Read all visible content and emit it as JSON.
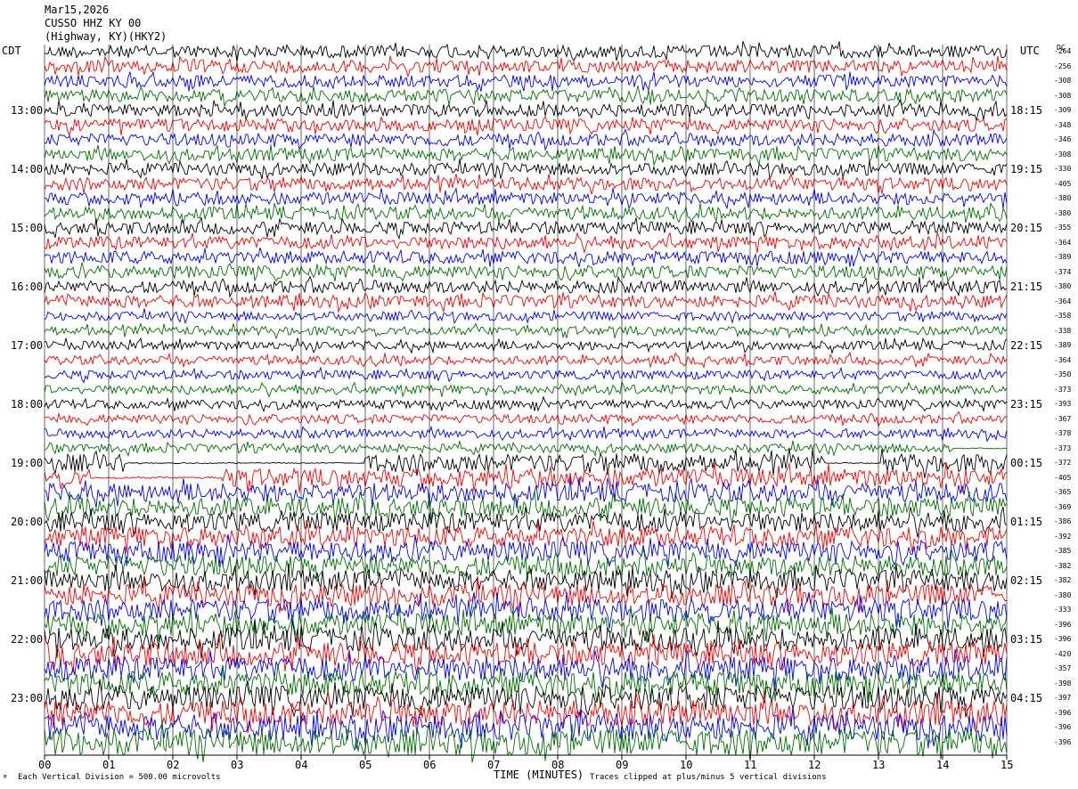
{
  "header": {
    "date": "Mar15,2026",
    "station": "CUSSO HHZ KY 00",
    "location": "(Highway, KY)(HKY2)"
  },
  "left_axis_title": "CDT",
  "right_axis_title": "UTC",
  "right_corner": "DC",
  "footer": {
    "scale_note": "Each Vertical Division =  500.00 microvolts",
    "xlabel": "TIME (MINUTES)",
    "clip_note": "Traces clipped at plus/minus 5 vertical divisions",
    "corner_mark": "ᴹ"
  },
  "colors": {
    "trace_cycle": [
      "#000000",
      "#ff0000",
      "#0000ff",
      "#007000"
    ]
  },
  "chart_data": {
    "type": "line",
    "title": "CUSSO HHZ KY 00",
    "xlabel": "TIME (MINUTES)",
    "xlim": [
      0,
      15
    ],
    "x_ticks": [
      "00",
      "01",
      "02",
      "03",
      "04",
      "05",
      "06",
      "07",
      "08",
      "09",
      "10",
      "11",
      "12",
      "13",
      "14",
      "15"
    ],
    "rows_per_hour": 4,
    "minutes_per_row": 15,
    "row_count": 48,
    "left_hour_labels": [
      "13:00",
      "14:00",
      "15:00",
      "16:00",
      "17:00",
      "18:00",
      "19:00",
      "20:00",
      "21:00",
      "22:00",
      "23:00"
    ],
    "right_hour_labels": [
      "18:15",
      "19:15",
      "20:15",
      "21:15",
      "22:15",
      "23:15",
      "00:15",
      "01:15",
      "02:15",
      "03:15",
      "04:15"
    ],
    "dc_offsets": [
      "-264",
      "-256",
      "-308",
      "-308",
      "-309",
      "-348",
      "-346",
      "-308",
      "-330",
      "-405",
      "-380",
      "-380",
      "-355",
      "-364",
      "-389",
      "-374",
      "-380",
      "-364",
      "-358",
      "-338",
      "-389",
      "-364",
      "-350",
      "-373",
      "-393",
      "-367",
      "-378",
      "-373",
      "-372",
      "-405",
      "-365",
      "-369",
      "-386",
      "-392",
      "-385",
      "-382",
      "-382",
      "-380",
      "-333",
      "-396",
      "-396",
      "-420",
      "-357",
      "-398",
      "-397",
      "-396",
      "-396",
      "-396"
    ],
    "clip_divisions": 5,
    "grid": true
  }
}
